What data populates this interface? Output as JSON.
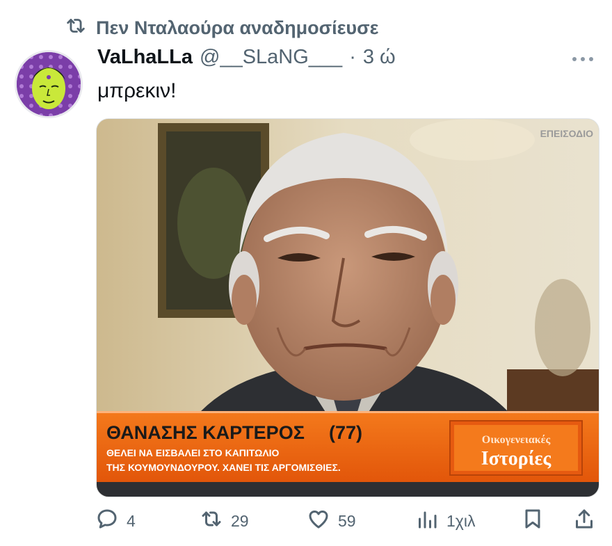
{
  "repost": {
    "text": "Πεν Νταλαούρα αναδημοσίευσε",
    "icon": "repost-icon"
  },
  "author": {
    "display_name": "VaLhaLLa",
    "handle": "@__SLaNG___",
    "separator": "·",
    "time": "3 ώ"
  },
  "tweet": {
    "text": "μπρεκιν!"
  },
  "media": {
    "corner_label": "ΕΠΕΙΣΟΔΙΟ",
    "lower_third": {
      "name": "ΘΑΝΑΣΗΣ ΚΑΡΤΕΡΟΣ",
      "age": "(77)",
      "line1": "ΘΕΛΕΙ ΝΑ ΕΙΣΒΑΛΕΙ ΣΤΟ ΚΑΠΙΤΩΛΙΟ",
      "line2": "ΤΗΣ ΚΟΥΜΟΥΝΔΟΥΡΟΥ. ΧΑΝΕΙ ΤΙΣ ΑΡΓΟΜΙΣΘΙΕΣ.",
      "logo_top": "Οικογενειακές",
      "logo_bottom": "Ιστορίες"
    }
  },
  "actions": {
    "replies": "4",
    "reposts": "29",
    "likes": "59",
    "views": "1χιλ"
  },
  "colors": {
    "accent_orange": "#f06a12",
    "muted": "#536471"
  }
}
